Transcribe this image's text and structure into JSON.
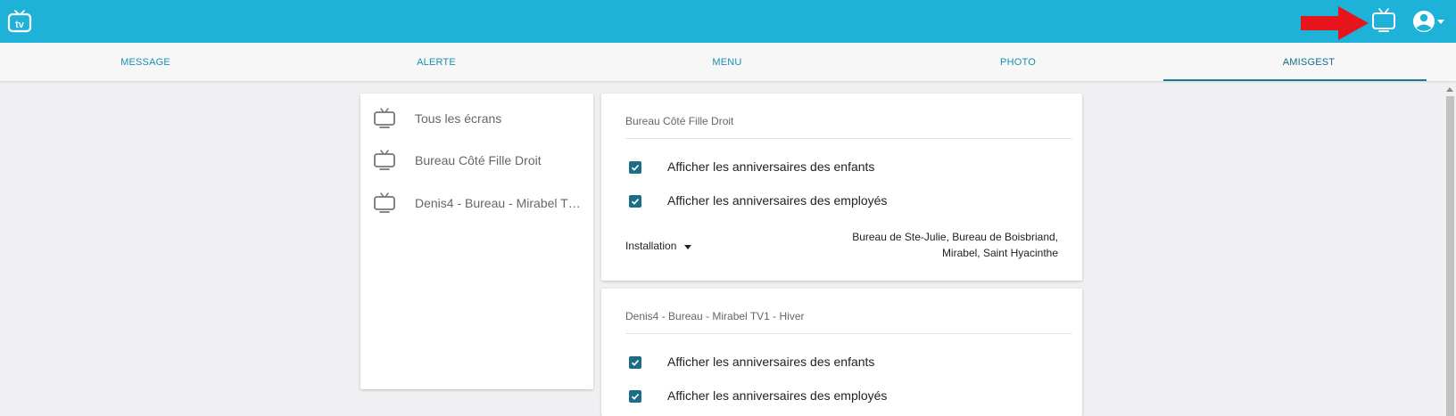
{
  "header": {
    "logo_text": "tv",
    "logo_icon": "tv-logo-icon",
    "annotation_arrow_color": "#e8141c",
    "screens_icon": "tv-icon",
    "account_icon": "account-circle-icon",
    "background_color": "#1fb2d8"
  },
  "tabs": [
    {
      "label": "MESSAGE",
      "active": false
    },
    {
      "label": "ALERTE",
      "active": false
    },
    {
      "label": "MENU",
      "active": false
    },
    {
      "label": "PHOTO",
      "active": false
    },
    {
      "label": "AMISGEST",
      "active": true
    }
  ],
  "screens": [
    {
      "label": "Tous les écrans"
    },
    {
      "label": "Bureau Côté Fille Droit"
    },
    {
      "label": "Denis4 - Bureau - Mirabel TV1 - Hiver"
    }
  ],
  "cards": [
    {
      "title": "Bureau Côté Fille Droit",
      "options": [
        {
          "label": "Afficher les anniversaires des enfants",
          "checked": true
        },
        {
          "label": "Afficher les anniversaires des employés",
          "checked": true
        }
      ],
      "installation_label": "Installation",
      "installation_line1": "Bureau de Ste-Julie, Bureau de Boisbriand,",
      "installation_line2": "Mirabel, Saint Hyacinthe"
    },
    {
      "title": "Denis4 - Bureau - Mirabel TV1 - Hiver",
      "options": [
        {
          "label": "Afficher les anniversaires des enfants",
          "checked": true
        },
        {
          "label": "Afficher les anniversaires des employés",
          "checked": true
        }
      ]
    }
  ],
  "colors": {
    "accent": "#1fb2d8",
    "tab_text": "#1a8fad",
    "checkbox": "#1d6d86"
  }
}
